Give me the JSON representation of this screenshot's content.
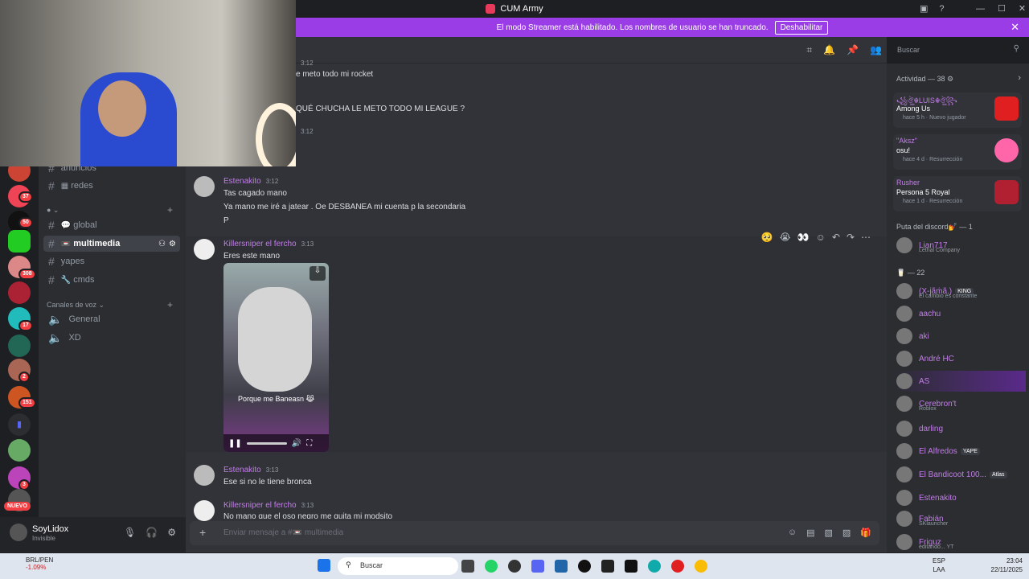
{
  "window": {
    "title": "CUM Army",
    "minimize": "—",
    "maximize": "☐",
    "close": "✕"
  },
  "banner": {
    "text": "El modo Streamer está habilitado. Los nombres de usuario se han truncado.",
    "button": "Deshabilitar"
  },
  "rail_badges": [
    "37",
    "50",
    "308",
    "17",
    "2",
    "151",
    "3"
  ],
  "rail_new": "NUEVO",
  "sidebar": {
    "channels_top": [
      {
        "name": "anuncios"
      },
      {
        "name": "redes"
      }
    ],
    "text_channels": [
      {
        "name": "global"
      },
      {
        "name": "multimedia"
      },
      {
        "name": "yapes"
      },
      {
        "name": "cmds"
      }
    ],
    "voice_category": "Canales de voz",
    "voice_channels": [
      {
        "name": "General"
      },
      {
        "name": "XD"
      }
    ]
  },
  "user": {
    "name": "SoyLidox",
    "status": "Invisible"
  },
  "search": {
    "placeholder": "Buscar"
  },
  "messages": [
    {
      "time": "3:12",
      "line": "e meto todo mi rocket"
    },
    {
      "line": "QUÉ CHUCHA LE METO TODO MI LEAGUE ?"
    },
    {
      "time": "3:12"
    },
    {
      "author": "Estenakito",
      "time": "3:12",
      "lines": [
        "Tas cagado mano",
        "Ya mano me iré a jatear . Oe DESBANEA mi cuenta p la secondaria",
        "P"
      ]
    },
    {
      "author": "Killersniper el fercho",
      "time": "3:13",
      "lines": [
        "Eres este mano"
      ],
      "video_caption": "Porque me Baneasn 😹"
    },
    {
      "author": "Estenakito",
      "time": "3:13",
      "lines": [
        "Ese si no le tiene bronca"
      ]
    },
    {
      "author": "Killersniper el fercho",
      "time": "3:13",
      "lines": [
        "No mano que el oso negro me quita mi modsito"
      ]
    }
  ],
  "composer": {
    "placeholder": "Enviar mensaje a #📼 multimedia"
  },
  "activity": {
    "header": "Actividad — 38",
    "cards": [
      {
        "name": "꧁ঔৣ☬LUIS☬ঔৣ꧂",
        "game": "Among Us",
        "time": "hace 5 h",
        "tag": "Nuevo jugador"
      },
      {
        "name": "\"Aksz\"",
        "game": "osu!",
        "time": "hace 4 d",
        "tag": "Resurrección"
      },
      {
        "name": "Rusher",
        "game": "Persona 5 Royal",
        "time": "hace 1 d",
        "tag": "Resurrección"
      }
    ]
  },
  "groups": [
    {
      "title": "Puta del discord💅 — 1",
      "members": [
        {
          "name": "Lian717",
          "sub": "Lethal Company"
        }
      ]
    },
    {
      "title": "🥛 — 22",
      "members": [
        {
          "name": "(X-jãṁã.)",
          "tag": "KING",
          "sub": "El cambio es constante"
        },
        {
          "name": "aachu"
        },
        {
          "name": "aki"
        },
        {
          "name": "André HC"
        },
        {
          "name": "AS"
        },
        {
          "name": "Cerebron't",
          "sub": "Roblox"
        },
        {
          "name": "darling"
        },
        {
          "name": "El Alfredos",
          "tag": "YAPE"
        },
        {
          "name": "El Bandicoot 100...",
          "tag": "Atlas"
        },
        {
          "name": "Estenakito"
        },
        {
          "name": "Fabián",
          "sub": "SKlauncher"
        },
        {
          "name": "Friguz",
          "sub": "editando... YT"
        }
      ]
    }
  ],
  "taskbar": {
    "weather_title": "BRL/PEN",
    "weather_value": "-1.09%",
    "search": "Buscar",
    "lang1": "ESP",
    "lang2": "LAA",
    "time": "23:04",
    "date": "22/11/2025"
  },
  "colors": {
    "accent": "#9b3de6",
    "name_purple": "#c27de8",
    "badge_red": "#f23f43"
  }
}
